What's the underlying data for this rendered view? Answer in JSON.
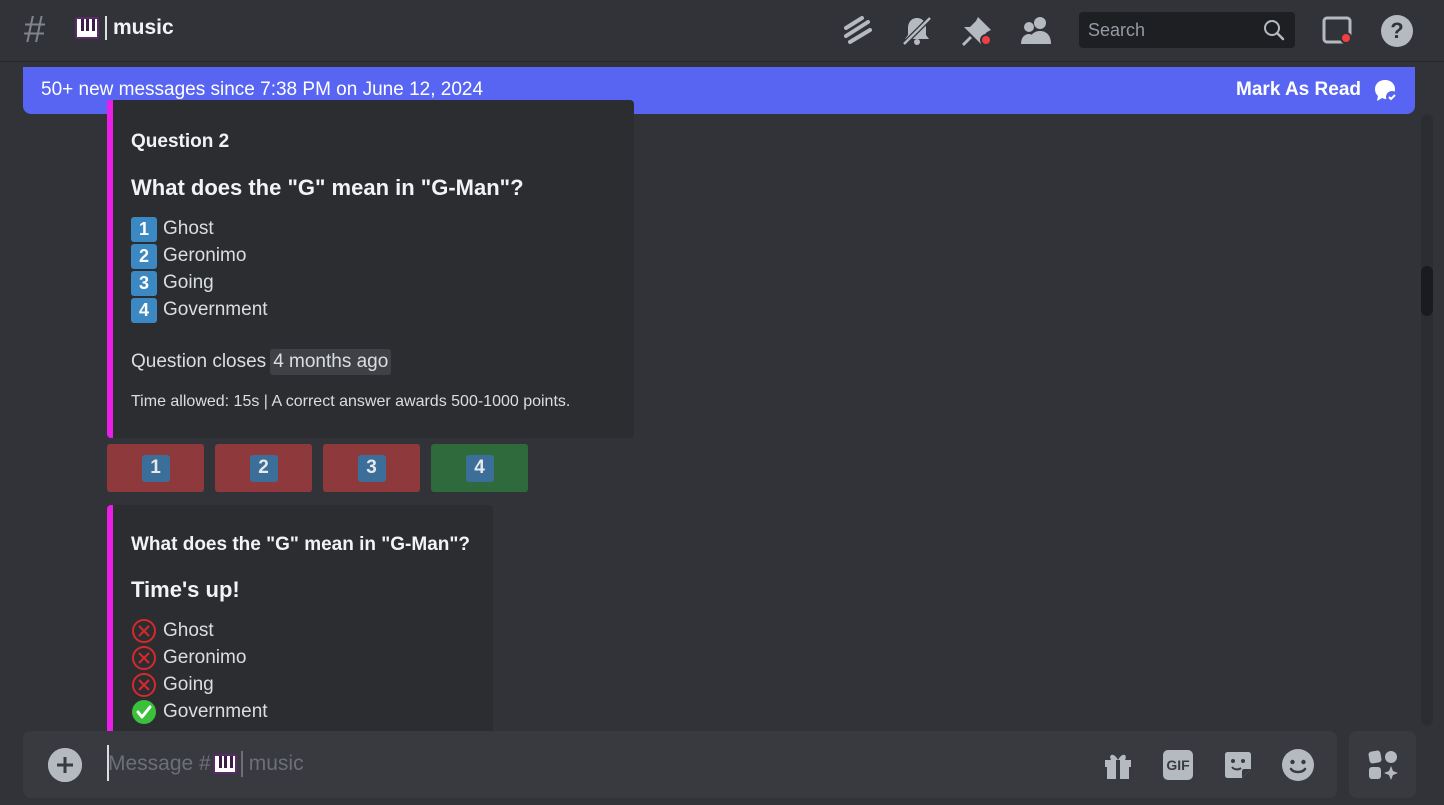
{
  "header": {
    "hash": "#",
    "channel_name": "music",
    "search_placeholder": "Search",
    "icons": [
      "threads-icon",
      "mute-bell-icon",
      "pin-icon",
      "members-icon",
      "inbox-icon",
      "help-icon"
    ]
  },
  "banner": {
    "text": "50+ new messages since 7:38 PM on June 12, 2024",
    "action": "Mark As Read"
  },
  "question_embed": {
    "author": "Question 2",
    "title": "What does the \"G\" mean in \"G-Man\"?",
    "options": [
      {
        "key": "1",
        "label": "Ghost"
      },
      {
        "key": "2",
        "label": "Geronimo"
      },
      {
        "key": "3",
        "label": "Going"
      },
      {
        "key": "4",
        "label": "Government"
      }
    ],
    "closes_label": "Question closes",
    "closes_time": "4 months ago",
    "footer": "Time allowed: 15s | A correct answer awards 500-1000 points."
  },
  "answer_buttons": [
    {
      "key": "1",
      "state": "wrong"
    },
    {
      "key": "2",
      "state": "wrong"
    },
    {
      "key": "3",
      "state": "wrong"
    },
    {
      "key": "4",
      "state": "correct"
    }
  ],
  "result_embed": {
    "author": "What does the \"G\" mean in \"G-Man\"?",
    "title": "Time's up!",
    "options": [
      {
        "label": "Ghost",
        "correct": false
      },
      {
        "label": "Geronimo",
        "correct": false
      },
      {
        "label": "Going",
        "correct": false
      },
      {
        "label": "Government",
        "correct": true
      }
    ]
  },
  "composer": {
    "placeholder_prefix": "Message #",
    "placeholder_channel": "music",
    "buttons": [
      "gift-icon",
      "GIF",
      "sticker-icon",
      "emoji-icon"
    ]
  },
  "colors": {
    "accent": "#5865f2",
    "embed_bar": "#e91ee7",
    "wrong": "#8e3a3d",
    "correct": "#2e6a3c",
    "keycap": "#3b88c3"
  }
}
